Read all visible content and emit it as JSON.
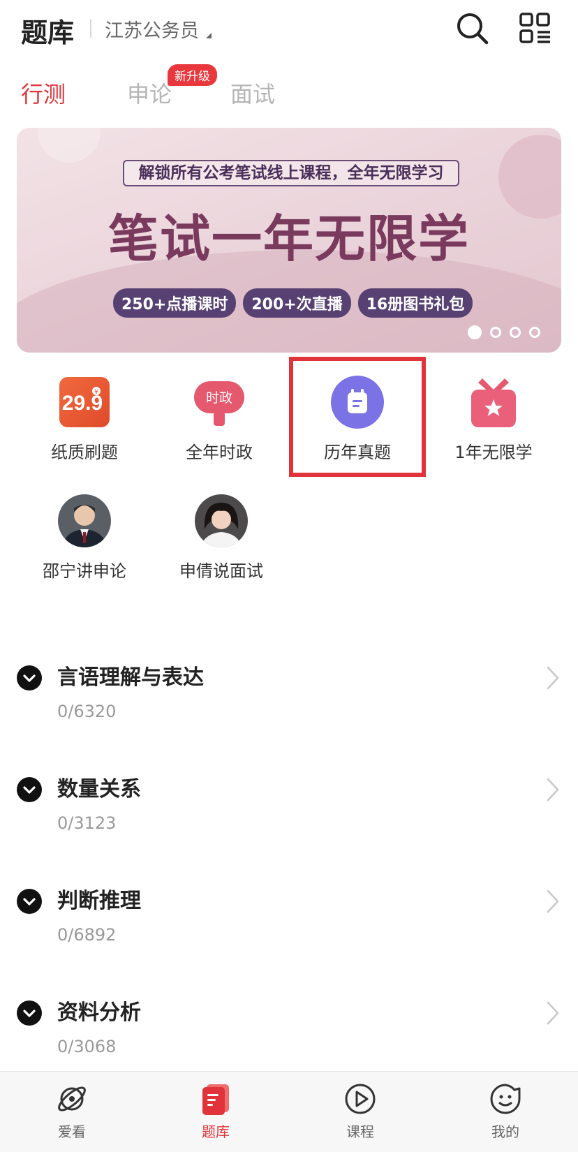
{
  "header": {
    "title": "题库",
    "exam_selector": "江苏公务员",
    "search_icon": "search-icon",
    "scan_icon": "qr-menu-icon"
  },
  "tabs": [
    {
      "label": "行测",
      "active": true
    },
    {
      "label": "申论",
      "active": false,
      "badge": "新升级"
    },
    {
      "label": "面试",
      "active": false
    }
  ],
  "banner": {
    "tagline": "解锁所有公考笔试线上课程，全年无限学习",
    "headline": "笔试一年无限学",
    "pills": [
      "250+点播课时",
      "200+次直播",
      "16册图书礼包"
    ],
    "page_count": 4,
    "active_page": 1
  },
  "entries": [
    {
      "label": "纸质刷题",
      "icon": "price-tag-icon",
      "icon_text": "29.9",
      "icon_badge": "¥"
    },
    {
      "label": "全年时政",
      "icon": "news-sign-icon",
      "icon_text": "时政"
    },
    {
      "label": "历年真题",
      "icon": "calendar-icon",
      "highlighted": true
    },
    {
      "label": "1年无限学",
      "icon": "star-gift-icon"
    },
    {
      "label": "邵宁讲申论",
      "icon": "teacher-avatar"
    },
    {
      "label": "申倩说面试",
      "icon": "teacher-avatar"
    }
  ],
  "categories": [
    {
      "title": "言语理解与表达",
      "progress": "0/6320"
    },
    {
      "title": "数量关系",
      "progress": "0/3123"
    },
    {
      "title": "判断推理",
      "progress": "0/6892"
    },
    {
      "title": "资料分析",
      "progress": "0/3068"
    }
  ],
  "bottom_nav": [
    {
      "label": "爱看",
      "icon": "planet-icon",
      "active": false
    },
    {
      "label": "题库",
      "icon": "question-bank-icon",
      "active": true
    },
    {
      "label": "课程",
      "icon": "play-icon",
      "active": false
    },
    {
      "label": "我的",
      "icon": "smile-face-icon",
      "active": false
    }
  ],
  "colors": {
    "accent": "#e0343a",
    "banner_purple": "#574173",
    "calendar_purple": "#7b72e6"
  }
}
